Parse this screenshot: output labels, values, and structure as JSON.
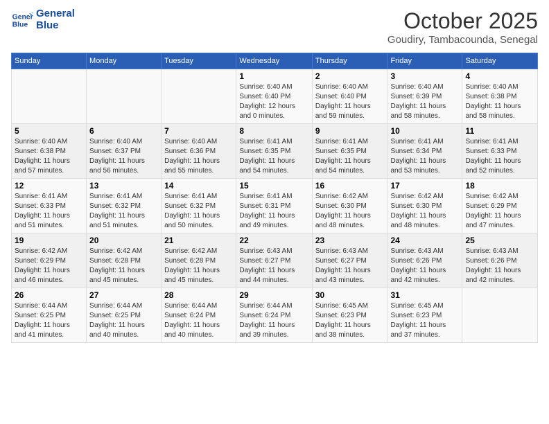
{
  "header": {
    "logo_line1": "General",
    "logo_line2": "Blue",
    "month_title": "October 2025",
    "subtitle": "Goudiry, Tambacounda, Senegal"
  },
  "weekdays": [
    "Sunday",
    "Monday",
    "Tuesday",
    "Wednesday",
    "Thursday",
    "Friday",
    "Saturday"
  ],
  "weeks": [
    [
      {
        "day": "",
        "info": ""
      },
      {
        "day": "",
        "info": ""
      },
      {
        "day": "",
        "info": ""
      },
      {
        "day": "1",
        "info": "Sunrise: 6:40 AM\nSunset: 6:40 PM\nDaylight: 12 hours\nand 0 minutes."
      },
      {
        "day": "2",
        "info": "Sunrise: 6:40 AM\nSunset: 6:40 PM\nDaylight: 11 hours\nand 59 minutes."
      },
      {
        "day": "3",
        "info": "Sunrise: 6:40 AM\nSunset: 6:39 PM\nDaylight: 11 hours\nand 58 minutes."
      },
      {
        "day": "4",
        "info": "Sunrise: 6:40 AM\nSunset: 6:38 PM\nDaylight: 11 hours\nand 58 minutes."
      }
    ],
    [
      {
        "day": "5",
        "info": "Sunrise: 6:40 AM\nSunset: 6:38 PM\nDaylight: 11 hours\nand 57 minutes."
      },
      {
        "day": "6",
        "info": "Sunrise: 6:40 AM\nSunset: 6:37 PM\nDaylight: 11 hours\nand 56 minutes."
      },
      {
        "day": "7",
        "info": "Sunrise: 6:40 AM\nSunset: 6:36 PM\nDaylight: 11 hours\nand 55 minutes."
      },
      {
        "day": "8",
        "info": "Sunrise: 6:41 AM\nSunset: 6:35 PM\nDaylight: 11 hours\nand 54 minutes."
      },
      {
        "day": "9",
        "info": "Sunrise: 6:41 AM\nSunset: 6:35 PM\nDaylight: 11 hours\nand 54 minutes."
      },
      {
        "day": "10",
        "info": "Sunrise: 6:41 AM\nSunset: 6:34 PM\nDaylight: 11 hours\nand 53 minutes."
      },
      {
        "day": "11",
        "info": "Sunrise: 6:41 AM\nSunset: 6:33 PM\nDaylight: 11 hours\nand 52 minutes."
      }
    ],
    [
      {
        "day": "12",
        "info": "Sunrise: 6:41 AM\nSunset: 6:33 PM\nDaylight: 11 hours\nand 51 minutes."
      },
      {
        "day": "13",
        "info": "Sunrise: 6:41 AM\nSunset: 6:32 PM\nDaylight: 11 hours\nand 51 minutes."
      },
      {
        "day": "14",
        "info": "Sunrise: 6:41 AM\nSunset: 6:32 PM\nDaylight: 11 hours\nand 50 minutes."
      },
      {
        "day": "15",
        "info": "Sunrise: 6:41 AM\nSunset: 6:31 PM\nDaylight: 11 hours\nand 49 minutes."
      },
      {
        "day": "16",
        "info": "Sunrise: 6:42 AM\nSunset: 6:30 PM\nDaylight: 11 hours\nand 48 minutes."
      },
      {
        "day": "17",
        "info": "Sunrise: 6:42 AM\nSunset: 6:30 PM\nDaylight: 11 hours\nand 48 minutes."
      },
      {
        "day": "18",
        "info": "Sunrise: 6:42 AM\nSunset: 6:29 PM\nDaylight: 11 hours\nand 47 minutes."
      }
    ],
    [
      {
        "day": "19",
        "info": "Sunrise: 6:42 AM\nSunset: 6:29 PM\nDaylight: 11 hours\nand 46 minutes."
      },
      {
        "day": "20",
        "info": "Sunrise: 6:42 AM\nSunset: 6:28 PM\nDaylight: 11 hours\nand 45 minutes."
      },
      {
        "day": "21",
        "info": "Sunrise: 6:42 AM\nSunset: 6:28 PM\nDaylight: 11 hours\nand 45 minutes."
      },
      {
        "day": "22",
        "info": "Sunrise: 6:43 AM\nSunset: 6:27 PM\nDaylight: 11 hours\nand 44 minutes."
      },
      {
        "day": "23",
        "info": "Sunrise: 6:43 AM\nSunset: 6:27 PM\nDaylight: 11 hours\nand 43 minutes."
      },
      {
        "day": "24",
        "info": "Sunrise: 6:43 AM\nSunset: 6:26 PM\nDaylight: 11 hours\nand 42 minutes."
      },
      {
        "day": "25",
        "info": "Sunrise: 6:43 AM\nSunset: 6:26 PM\nDaylight: 11 hours\nand 42 minutes."
      }
    ],
    [
      {
        "day": "26",
        "info": "Sunrise: 6:44 AM\nSunset: 6:25 PM\nDaylight: 11 hours\nand 41 minutes."
      },
      {
        "day": "27",
        "info": "Sunrise: 6:44 AM\nSunset: 6:25 PM\nDaylight: 11 hours\nand 40 minutes."
      },
      {
        "day": "28",
        "info": "Sunrise: 6:44 AM\nSunset: 6:24 PM\nDaylight: 11 hours\nand 40 minutes."
      },
      {
        "day": "29",
        "info": "Sunrise: 6:44 AM\nSunset: 6:24 PM\nDaylight: 11 hours\nand 39 minutes."
      },
      {
        "day": "30",
        "info": "Sunrise: 6:45 AM\nSunset: 6:23 PM\nDaylight: 11 hours\nand 38 minutes."
      },
      {
        "day": "31",
        "info": "Sunrise: 6:45 AM\nSunset: 6:23 PM\nDaylight: 11 hours\nand 37 minutes."
      },
      {
        "day": "",
        "info": ""
      }
    ]
  ]
}
